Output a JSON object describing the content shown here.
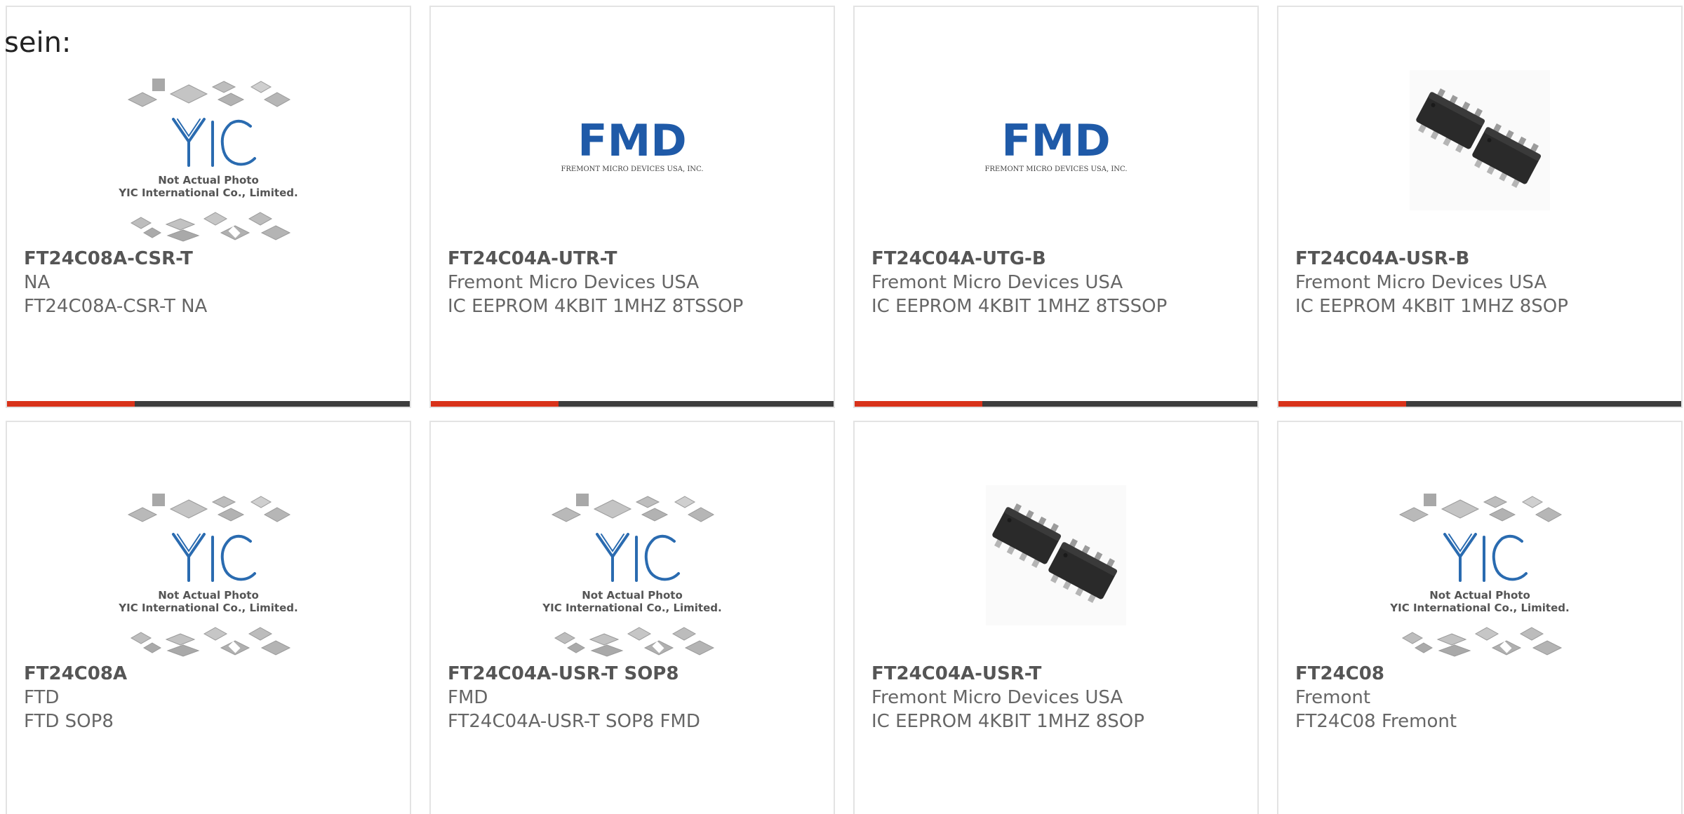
{
  "intro_text": "sein:",
  "colors": {
    "card_border": "#e3e3e3",
    "accent": "#d8321a",
    "bar_dark": "#3d3d3d",
    "fmd_blue": "#1f5aa8",
    "yic_blue": "#2a6bb0"
  },
  "placeholder_image": {
    "caption_line1": "Not Actual Photo",
    "caption_line2": "YIC International Co., Limited.",
    "logo": "YIC"
  },
  "fmd_logo": {
    "mark": "FMD",
    "tagline": "FREMONT MICRO DEVICES USA, INC."
  },
  "products": [
    {
      "part_number": "FT24C08A-CSR-T",
      "manufacturer": "NA",
      "description": "FT24C08A-CSR-T NA",
      "image": "not-actual-photo"
    },
    {
      "part_number": "FT24C04A-UTR-T",
      "manufacturer": "Fremont Micro Devices USA",
      "description": "IC EEPROM 4KBIT 1MHZ 8TSSOP",
      "image": "fmd-logo"
    },
    {
      "part_number": "FT24C04A-UTG-B",
      "manufacturer": "Fremont Micro Devices USA",
      "description": "IC EEPROM 4KBIT 1MHZ 8TSSOP",
      "image": "fmd-logo"
    },
    {
      "part_number": "FT24C04A-USR-B",
      "manufacturer": "Fremont Micro Devices USA",
      "description": "IC EEPROM 4KBIT 1MHZ 8SOP",
      "image": "sop8-chips"
    },
    {
      "part_number": "FT24C08A",
      "manufacturer": "FTD",
      "description": "FTD SOP8",
      "image": "not-actual-photo"
    },
    {
      "part_number": "FT24C04A-USR-T SOP8",
      "manufacturer": "FMD",
      "description": "FT24C04A-USR-T SOP8 FMD",
      "image": "not-actual-photo"
    },
    {
      "part_number": "FT24C04A-USR-T",
      "manufacturer": "Fremont Micro Devices USA",
      "description": "IC EEPROM 4KBIT 1MHZ 8SOP",
      "image": "sop8-chips"
    },
    {
      "part_number": "FT24C08",
      "manufacturer": "Fremont",
      "description": "FT24C08 Fremont",
      "image": "not-actual-photo"
    }
  ]
}
